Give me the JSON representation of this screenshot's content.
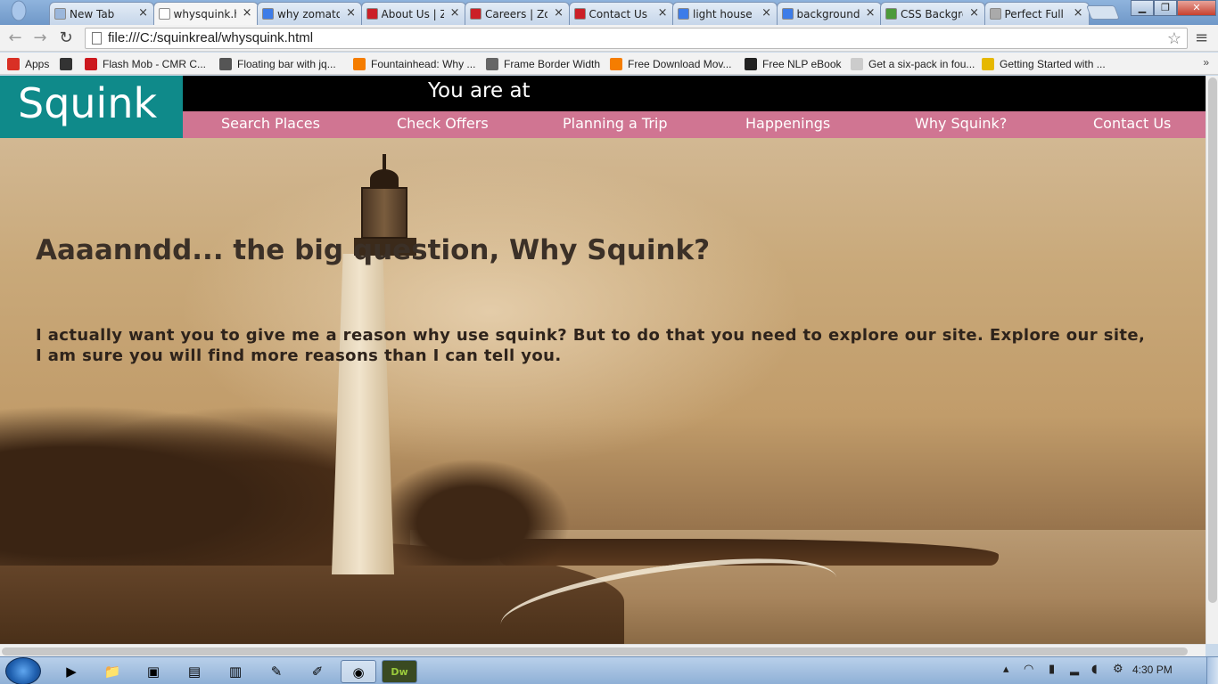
{
  "browser": {
    "tabs": [
      {
        "label": "New Tab",
        "favicon_color": "#9bb7db",
        "active": false
      },
      {
        "label": "whysquink.h",
        "favicon_color": "#ffffff",
        "active": true
      },
      {
        "label": "why zomato",
        "favicon_color": "#3d7ce8",
        "active": false
      },
      {
        "label": "About Us | Z",
        "favicon_color": "#cb2027",
        "active": false
      },
      {
        "label": "Careers | Zo",
        "favicon_color": "#cb2027",
        "active": false
      },
      {
        "label": "Contact Us",
        "favicon_color": "#cb2027",
        "active": false
      },
      {
        "label": "light house",
        "favicon_color": "#3d7ce8",
        "active": false
      },
      {
        "label": "background",
        "favicon_color": "#3d7ce8",
        "active": false
      },
      {
        "label": "CSS Backgro",
        "favicon_color": "#4c9a3a",
        "active": false
      },
      {
        "label": "Perfect Full",
        "favicon_color": "#aaaaaa",
        "active": false
      }
    ],
    "url": "file:///C:/squinkreal/whysquink.html",
    "bookmarks": [
      {
        "label": "Apps",
        "color": "#d93025"
      },
      {
        "label": "",
        "color": "#333333"
      },
      {
        "label": "Flash Mob - CMR C...",
        "color": "#cc181e"
      },
      {
        "label": "Floating bar with jq...",
        "color": "#555555"
      },
      {
        "label": "Fountainhead: Why ...",
        "color": "#f57d00"
      },
      {
        "label": "Frame Border Width",
        "color": "#666666"
      },
      {
        "label": "Free Download Mov...",
        "color": "#f57d00"
      },
      {
        "label": "Free NLP eBook",
        "color": "#222222"
      },
      {
        "label": "Get a six-pack in fou...",
        "color": "#cccccc"
      },
      {
        "label": "Getting Started with ...",
        "color": "#e6b800"
      }
    ],
    "bookmarks_more": "»"
  },
  "site": {
    "logo": "Squink",
    "location_label": "You are at",
    "nav": [
      "Search Places",
      "Check Offers",
      "Planning a Trip",
      "Happenings",
      "Why Squink?",
      "Contact Us"
    ],
    "heading": "Aaaanndd... the big question, Why Squink?",
    "body": "I actually want you to give me a reason why use squink? But to do that you need to explore our site. Explore our site, I am sure you will find more reasons than I can tell you.",
    "colors": {
      "logo_bg": "#0f8a8a",
      "topbar_bg": "#000000",
      "nav_bg": "#d07592"
    }
  },
  "taskbar": {
    "clock": "4:30 PM"
  }
}
